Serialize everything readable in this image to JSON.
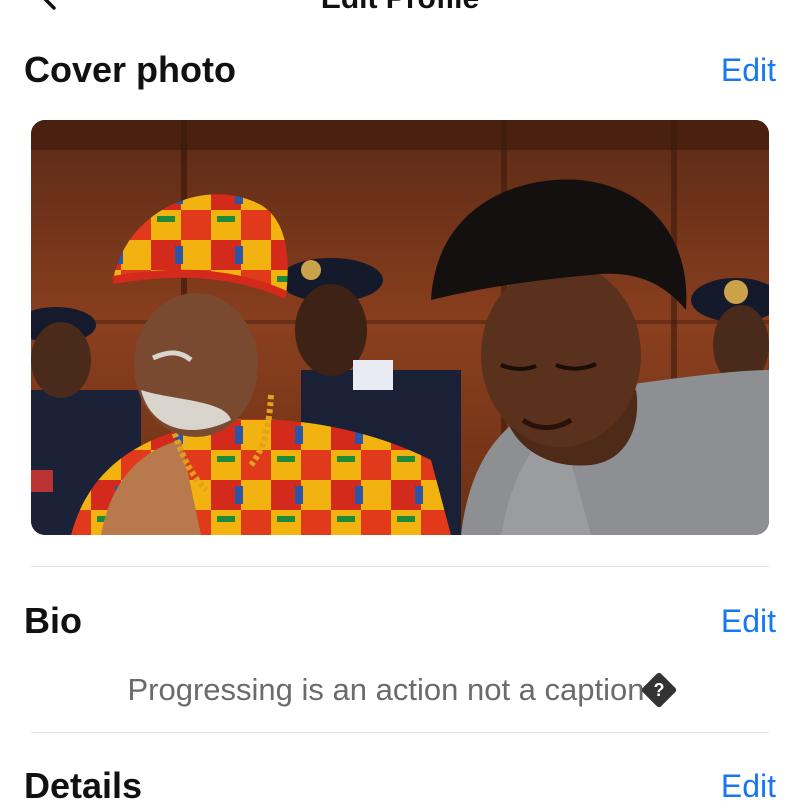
{
  "header": {
    "title": "Edit Profile"
  },
  "cover": {
    "label": "Cover photo",
    "edit_label": "Edit"
  },
  "bio": {
    "label": "Bio",
    "edit_label": "Edit",
    "text": "Progressing is an action not a caption",
    "replacement_char": "?"
  },
  "details": {
    "label": "Details",
    "edit_label": "Edit"
  },
  "colors": {
    "accent": "#1877f2",
    "divider": "#e2e2e2",
    "muted_text": "#6b6b6b"
  }
}
